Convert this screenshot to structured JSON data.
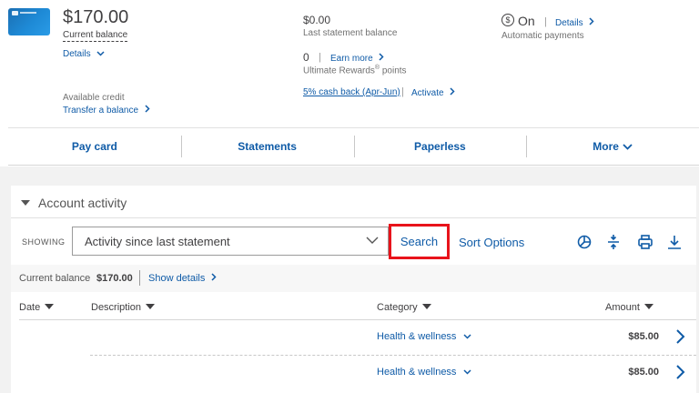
{
  "account": {
    "balance": "$170.00",
    "balance_label": "Current balance",
    "details_label": "Details",
    "available_credit_label": "Available credit",
    "transfer_label": "Transfer a balance"
  },
  "statement": {
    "amount": "$0.00",
    "label": "Last statement balance"
  },
  "rewards": {
    "points": "0",
    "earn_more": "Earn more",
    "label_prefix": "Ultimate Rewards",
    "label_sup": "®",
    "label_suffix": " points",
    "cashback_link": "5% cash back (Apr-Jun)",
    "activate_label": "Activate"
  },
  "autopay": {
    "status": "On",
    "details_label": "Details",
    "label": "Automatic payments"
  },
  "nav": {
    "items": [
      "Pay card",
      "Statements",
      "Paperless",
      "More"
    ]
  },
  "activity": {
    "title": "Account activity",
    "showing_label": "SHOWING",
    "filter_value": "Activity since last statement",
    "search_label": "Search",
    "sort_label": "Sort Options",
    "current_balance_label": "Current balance",
    "current_balance_value": "$170.00",
    "show_details": "Show details",
    "columns": [
      "Date",
      "Description",
      "Category",
      "Amount"
    ],
    "rows": [
      {
        "date": "",
        "description": "",
        "category": "Health & wellness",
        "amount": "$85.00"
      },
      {
        "date": "",
        "description": "",
        "category": "Health & wellness",
        "amount": "$85.00"
      }
    ]
  },
  "icons": {
    "tools": [
      "spending-chart-icon",
      "expand-collapse-icon",
      "print-icon",
      "download-icon"
    ]
  },
  "colors": {
    "link": "#0f5ba7",
    "highlight": "#e8131b",
    "text": "#414042",
    "background": "#f2f2f2"
  }
}
